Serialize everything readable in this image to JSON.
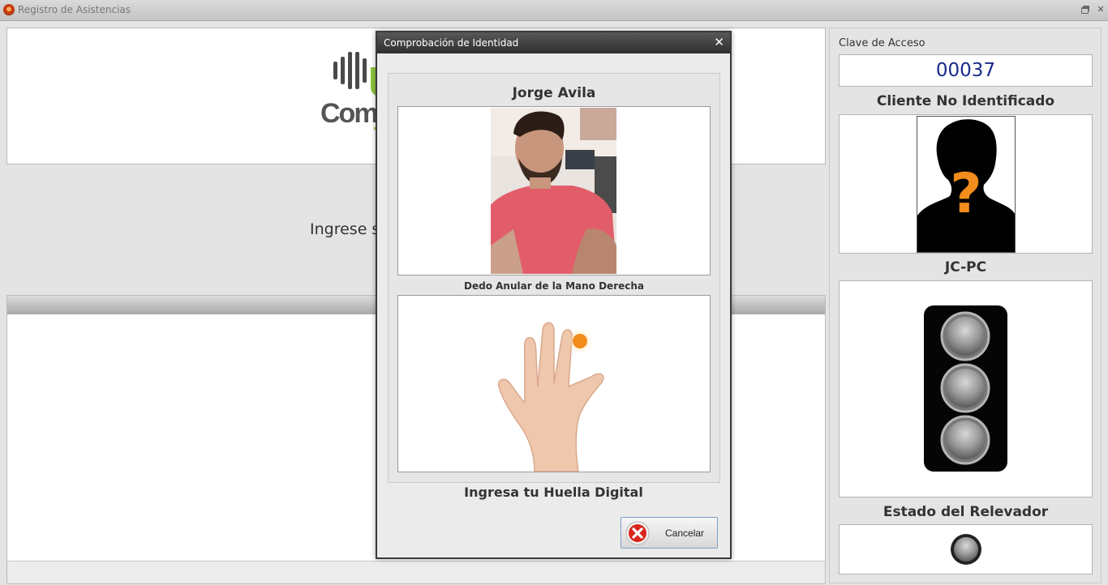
{
  "window": {
    "title": "Registro de Asistencias"
  },
  "main": {
    "logo_text": "Comp",
    "prompt": "Ingrese s"
  },
  "right_panel": {
    "clave_label": "Clave de Acceso",
    "clave_value": "00037",
    "client_status": "Cliente No Identificado",
    "pc_name": "JC-PC",
    "relay_label": "Estado del Relevador"
  },
  "dialog": {
    "title": "Comprobación de Identidad",
    "close_glyph": "✕",
    "person_name": "Jorge Avila",
    "finger_label": "Dedo Anular de la Mano Derecha",
    "instruction": "Ingresa tu Huella Digital",
    "cancel_label": "Cancelar"
  },
  "colors": {
    "accent_orange": "#f28c1c",
    "clave_blue": "#1a2a8c",
    "brand_green": "#8dc63f",
    "cancel_red": "#d9261c"
  }
}
